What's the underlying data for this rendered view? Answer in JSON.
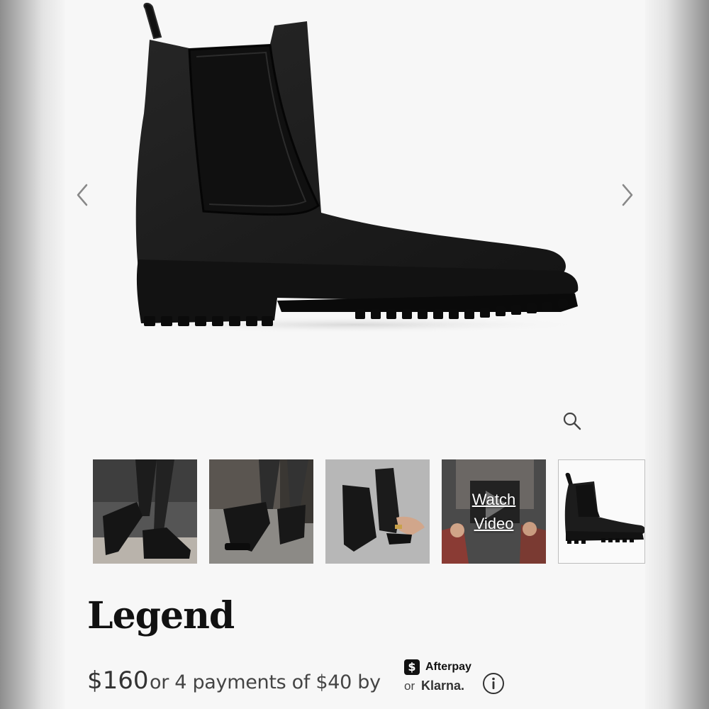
{
  "product": {
    "title": "Legend",
    "price": "$160",
    "installments_text": "or 4 payments of $40 by",
    "afterpay_label": "Afterpay",
    "afterpay_badge": "$",
    "or_label": "or",
    "klarna_label": "Klarna."
  },
  "gallery": {
    "prev_icon": "chevron-left-icon",
    "next_icon": "chevron-right-icon",
    "zoom_icon": "zoom-icon",
    "thumbnails": [
      {
        "kind": "photo"
      },
      {
        "kind": "photo"
      },
      {
        "kind": "photo"
      },
      {
        "kind": "video",
        "label_line1": "Watch",
        "label_line2": "Video"
      },
      {
        "kind": "photo",
        "selected": true
      }
    ]
  },
  "colors": {
    "page_bg": "#f7f7f7",
    "boot": "#1a1a1a",
    "text_primary": "#111111"
  }
}
